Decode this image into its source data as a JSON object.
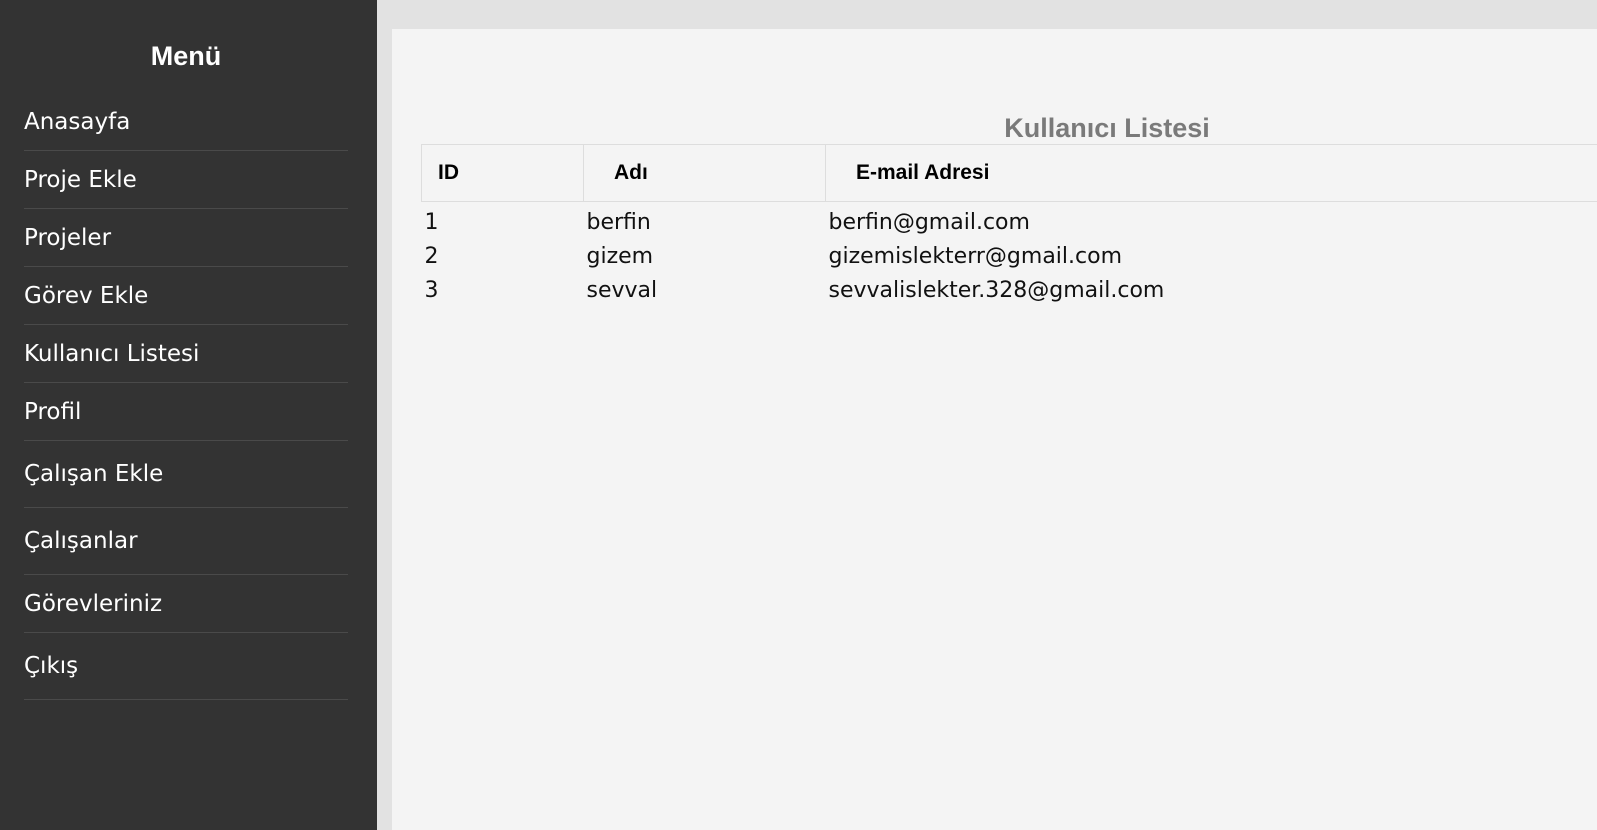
{
  "sidebar": {
    "title": "Menü",
    "items": [
      {
        "label": "Anasayfa"
      },
      {
        "label": "Proje Ekle"
      },
      {
        "label": "Projeler"
      },
      {
        "label": "Görev Ekle"
      },
      {
        "label": "Kullanıcı Listesi"
      },
      {
        "label": "Profil"
      },
      {
        "label": "Çalışan Ekle"
      },
      {
        "label": "Çalışanlar"
      },
      {
        "label": "Görevleriniz"
      },
      {
        "label": "Çıkış"
      }
    ]
  },
  "main": {
    "title": "Kullanıcı Listesi",
    "table": {
      "headers": [
        "ID",
        "Adı",
        "E-mail Adresi"
      ],
      "rows": [
        {
          "id": "1",
          "name": "berfin",
          "email": "berfin@gmail.com"
        },
        {
          "id": "2",
          "name": "gizem",
          "email": "gizemislekterr@gmail.com"
        },
        {
          "id": "3",
          "name": "sevval",
          "email": "sevvalislekter.328@gmail.com"
        }
      ]
    }
  },
  "colors": {
    "sidebar_bg": "#333333",
    "page_bg": "#e2e2e2",
    "panel_bg": "#f4f4f4",
    "title_gray": "#7a7a7a"
  }
}
